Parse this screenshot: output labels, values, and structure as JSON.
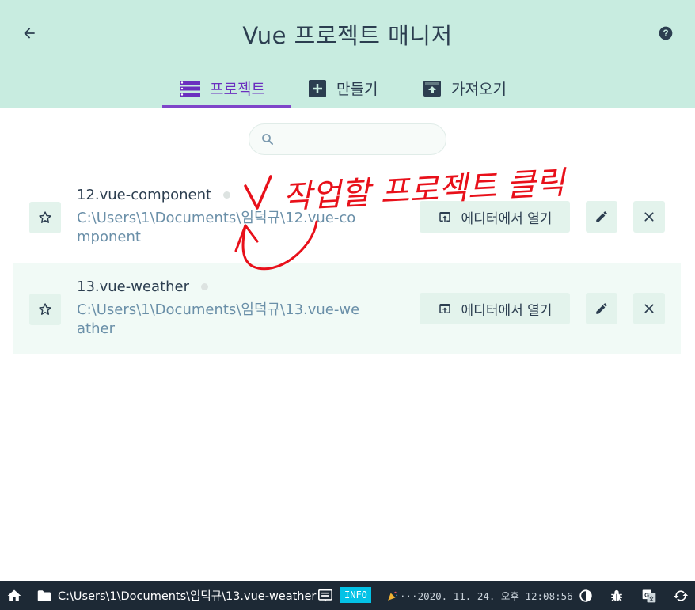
{
  "header": {
    "title": "Vue 프로젝트 매니저",
    "tabs": [
      {
        "label": "프로젝트",
        "active": true
      },
      {
        "label": "만들기",
        "active": false
      },
      {
        "label": "가져오기",
        "active": false
      }
    ]
  },
  "search": {
    "placeholder": ""
  },
  "projects": [
    {
      "name": "12.vue-component",
      "path": "C:\\Users\\1\\Documents\\임덕규\\12.vue-component",
      "open_label": "에디터에서 열기"
    },
    {
      "name": "13.vue-weather",
      "path": "C:\\Users\\1\\Documents\\임덕규\\13.vue-weather",
      "open_label": "에디터에서 열기"
    }
  ],
  "annotation": {
    "text": "작업할 프로젝트 클릭"
  },
  "statusbar": {
    "path": "C:\\Users\\1\\Documents\\임덕규\\13.vue-weather",
    "info_badge": "INFO",
    "message": "···2020. 11. 24. 오후 12:08:56"
  },
  "colors": {
    "header_bg": "#c8ece0",
    "accent": "#7f45c9",
    "path_text": "#6a8fa8",
    "button_bg": "#e3f3ec",
    "statusbar_bg": "#1d2935",
    "info_badge": "#03c2e6",
    "annotation": "#e8101a"
  },
  "icons": {
    "back": "arrow-left-icon",
    "help": "help-circle-icon",
    "projects_tab": "list-icon",
    "create_tab": "add-box-icon",
    "import_tab": "unarchive-icon",
    "search": "search-icon",
    "star": "star-outline-icon",
    "open": "open-in-browser-icon",
    "edit": "pencil-icon",
    "delete": "close-icon",
    "home": "home-icon",
    "folder": "folder-icon",
    "log": "message-icon",
    "party": "party-popper-icon",
    "theme": "contrast-icon",
    "bug": "bug-icon",
    "translate": "translate-icon",
    "refresh": "refresh-icon"
  }
}
